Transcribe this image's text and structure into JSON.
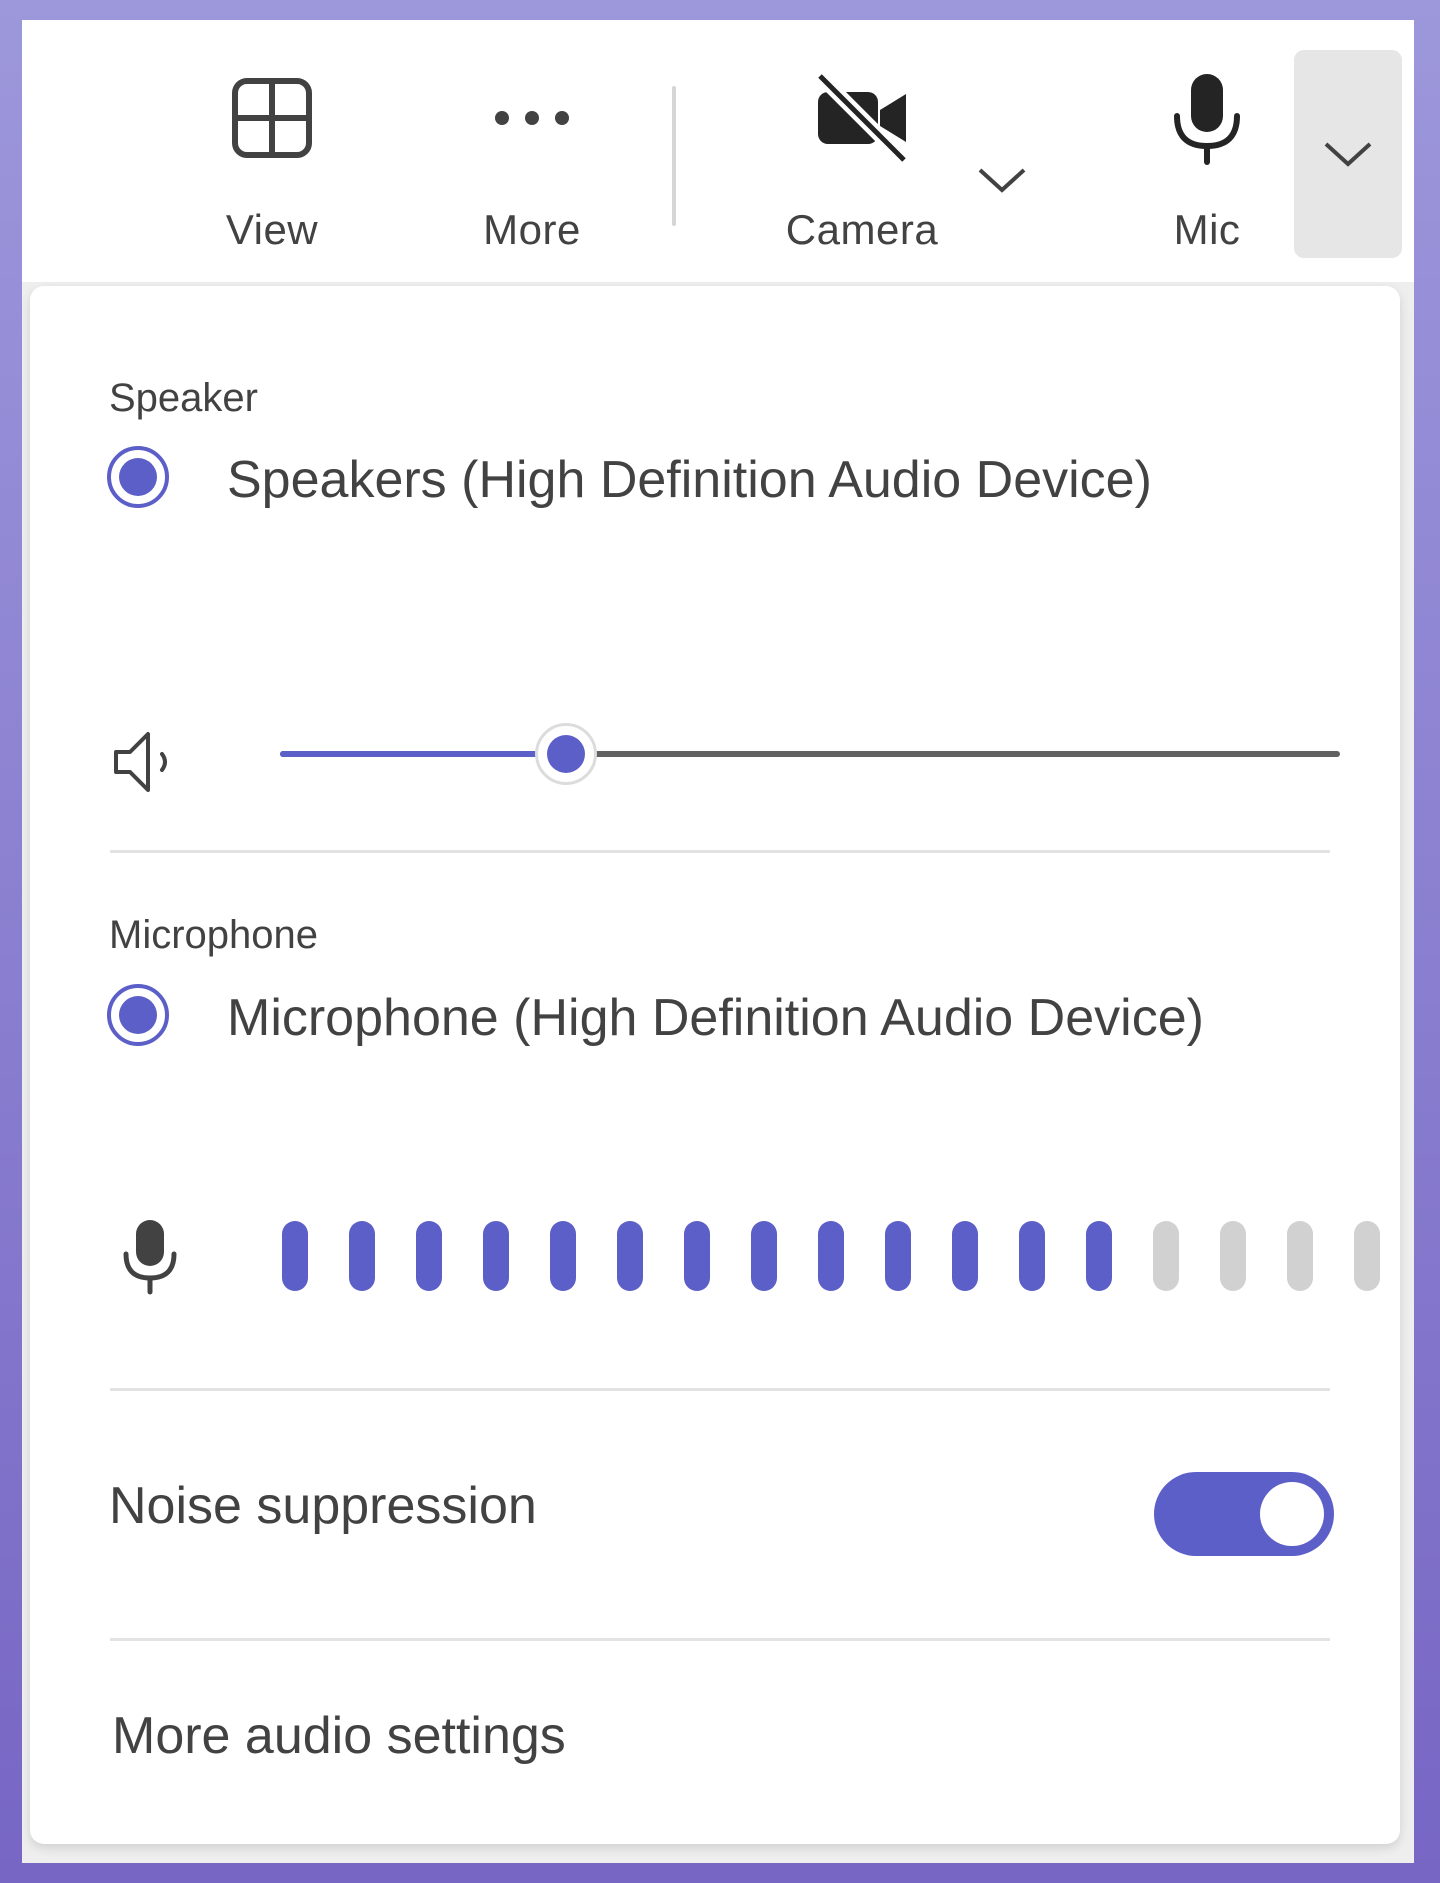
{
  "toolbar": {
    "view_label": "View",
    "more_label": "More",
    "camera_label": "Camera",
    "mic_label": "Mic",
    "camera_state": "off"
  },
  "speaker": {
    "title": "Speaker",
    "device": "Speakers (High Definition Audio Device)",
    "selected": true,
    "volume": 0.27
  },
  "microphone": {
    "title": "Microphone",
    "device": "Microphone (High Definition Audio Device)",
    "selected": true,
    "level_bars_total": 17,
    "level_bars_active": 13
  },
  "noise_suppression": {
    "label": "Noise suppression",
    "on": true
  },
  "more_audio_settings": "More audio settings",
  "colors": {
    "accent": "#5b5fc7",
    "inactive_bar": "#d1d1d1",
    "text": "#424242"
  },
  "icons": {
    "view": "grid-icon",
    "more": "more-dots-icon",
    "camera": "camera-off-icon",
    "mic": "mic-icon",
    "speaker": "speaker-icon",
    "chevron": "chevron-down-icon"
  }
}
